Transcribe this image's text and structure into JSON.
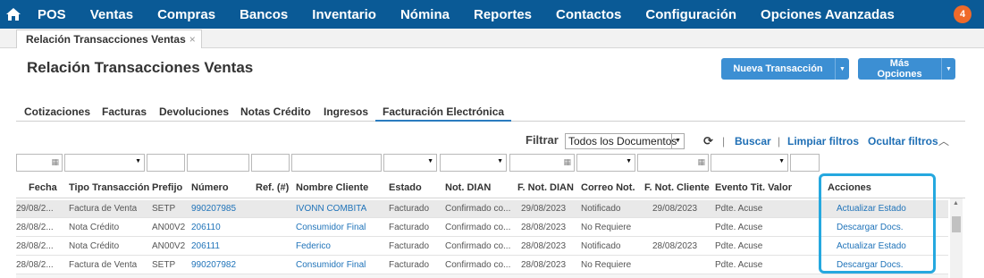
{
  "nav": {
    "items": [
      "POS",
      "Ventas",
      "Compras",
      "Bancos",
      "Inventario",
      "Nómina",
      "Reportes",
      "Contactos",
      "Configuración",
      "Opciones Avanzadas"
    ],
    "badge": "4"
  },
  "tabbar": {
    "tab_label": "Relación Transacciones Ventas",
    "close": "×"
  },
  "page": {
    "title": "Relación Transacciones Ventas",
    "btn_new": "Nueva Transacción",
    "btn_more": "Más Opciones"
  },
  "subtabs": [
    "Cotizaciones",
    "Facturas",
    "Devoluciones",
    "Notas Crédito",
    "Ingresos",
    "Facturación Electrónica"
  ],
  "filter": {
    "label": "Filtrar",
    "selected": "Todos los Documentos",
    "buscar": "Buscar",
    "limpiar": "Limpiar filtros",
    "ocultar": "Ocultar filtros",
    "sep": "|"
  },
  "columns": [
    "Fecha",
    "Tipo Transacción",
    "Prefijo",
    "Número",
    "Ref. (#)",
    "Nombre Cliente",
    "Estado",
    "Not. DIAN",
    "F. Not. DIAN",
    "Correo Not.",
    "F. Not. Cliente",
    "Evento Tit. Valor",
    "Acciones"
  ],
  "rows": [
    {
      "fecha": "29/08/2...",
      "tipo": "Factura de Venta",
      "prefijo": "SETP",
      "numero": "990207985",
      "ref": "",
      "cliente": "IVONN COMBITA",
      "estado": "Facturado",
      "dian": "Confirmado co...",
      "fdian": "29/08/2023",
      "correo": "Notificado",
      "fcliente": "29/08/2023",
      "evento": "Pdte. Acuse",
      "accion": "Actualizar Estado"
    },
    {
      "fecha": "28/08/2...",
      "tipo": "Nota Crédito",
      "prefijo": "AN00V2",
      "numero": "206110",
      "ref": "",
      "cliente": "Consumidor Final",
      "estado": "Facturado",
      "dian": "Confirmado co...",
      "fdian": "28/08/2023",
      "correo": "No Requiere",
      "fcliente": "",
      "evento": "Pdte. Acuse",
      "accion": "Descargar Docs."
    },
    {
      "fecha": "28/08/2...",
      "tipo": "Nota Crédito",
      "prefijo": "AN00V2",
      "numero": "206111",
      "ref": "",
      "cliente": "Federico",
      "estado": "Facturado",
      "dian": "Confirmado co...",
      "fdian": "28/08/2023",
      "correo": "Notificado",
      "fcliente": "28/08/2023",
      "evento": "Pdte. Acuse",
      "accion": "Actualizar Estado"
    },
    {
      "fecha": "28/08/2...",
      "tipo": "Factura de Venta",
      "prefijo": "SETP",
      "numero": "990207982",
      "ref": "",
      "cliente": "Consumidor Final",
      "estado": "Facturado",
      "dian": "Confirmado co...",
      "fdian": "28/08/2023",
      "correo": "No Requiere",
      "fcliente": "",
      "evento": "Pdte. Acuse",
      "accion": "Descargar Docs."
    }
  ],
  "colors": {
    "nav": "#0a5a96",
    "accent": "#3c8fd3",
    "link": "#1f73b9",
    "highlight": "#25a8df",
    "badge": "#ef6a2a"
  }
}
